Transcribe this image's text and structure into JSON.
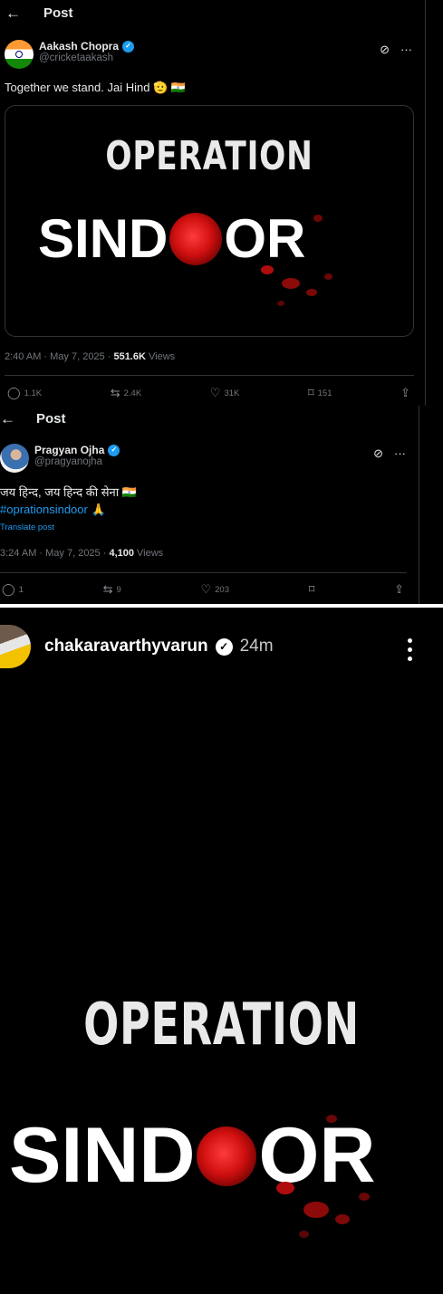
{
  "post1": {
    "header_title": "Post",
    "author_name": "Aakash Chopra",
    "handle": "@cricketaakash",
    "text": "Together we stand. Jai Hind 🫡 🇮🇳",
    "image": {
      "line1": "OPERATION",
      "line2a": "SIND",
      "line2b": "OR"
    },
    "time": "2:40 AM · May 7, 2025 · ",
    "views_count": "551.6K",
    "views_label": " Views",
    "actions": {
      "replies": "1.1K",
      "reposts": "2.4K",
      "likes": "31K",
      "bookmarks": "151"
    }
  },
  "post2": {
    "header_title": "Post",
    "author_name": "Pragyan Ojha",
    "handle": "@pragyanojha",
    "text": "जय हिन्द, जय हिन्द की सेना 🇮🇳",
    "hashtag": "#oprationsindoor",
    "hashtag_emoji": " 🙏",
    "translate": "Translate post",
    "time": "3:24 AM · May 7, 2025 · ",
    "views_count": "4,100",
    "views_label": " Views",
    "actions": {
      "replies": "1",
      "reposts": "9",
      "likes": "203"
    }
  },
  "story": {
    "username": "chakaravarthyvarun",
    "time": "24m",
    "image": {
      "line1": "OPERATION",
      "line2a": "SIND",
      "line2b": "OR"
    }
  },
  "icons": {
    "back": "←",
    "grok": "⊘",
    "more": "···",
    "reply": "◯",
    "repost": "⇆",
    "like": "♡",
    "bookmark": "⌑",
    "share": "⇪",
    "verified": "✓"
  },
  "colors": {
    "accent": "#1d9bf0",
    "background": "#000000",
    "muted": "#71767b",
    "sindoor_red": "#d01010"
  }
}
